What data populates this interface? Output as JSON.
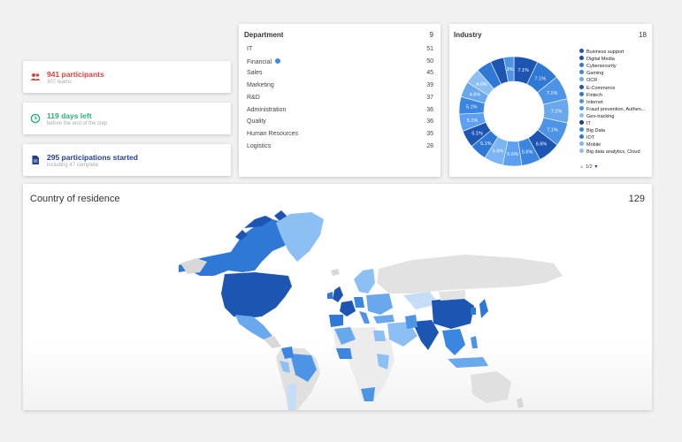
{
  "stats": [
    {
      "title": "941 participants",
      "subtitle": "307 teams",
      "color": "#e0413b",
      "icon": "people-icon"
    },
    {
      "title": "119 days left",
      "subtitle": "before the end of the step",
      "color": "#2aae7d",
      "icon": "clock-icon"
    },
    {
      "title": "295 participations started",
      "subtitle": "including 47 complete",
      "color": "#23408e",
      "icon": "document-icon"
    }
  ],
  "department": {
    "title": "Department",
    "count": "9",
    "rows": [
      {
        "label": "IT",
        "value": "51"
      },
      {
        "label": "Financial",
        "value": "50",
        "verified": true
      },
      {
        "label": "Sales",
        "value": "45"
      },
      {
        "label": "Marketing",
        "value": "39"
      },
      {
        "label": "R&D",
        "value": "37"
      },
      {
        "label": "Administration",
        "value": "36"
      },
      {
        "label": "Quality",
        "value": "36"
      },
      {
        "label": "Human Resources",
        "value": "35"
      },
      {
        "label": "Logistics",
        "value": "28"
      }
    ]
  },
  "industry": {
    "title": "Industry",
    "count": "18",
    "segments": [
      {
        "label": "7.1%",
        "value": 7.1,
        "color": "#1d55b3"
      },
      {
        "label": "7.1%",
        "value": 7.1,
        "color": "#2f78d6"
      },
      {
        "label": "7.1%",
        "value": 7.1,
        "color": "#4d94e6"
      },
      {
        "label": "7.1%",
        "value": 7.1,
        "color": "#6aa8ee"
      },
      {
        "label": "7.1%",
        "value": 7.1,
        "color": "#4d94e6"
      },
      {
        "label": "6.6%",
        "value": 6.6,
        "color": "#1d55b3"
      },
      {
        "label": "5.6%",
        "value": 5.6,
        "color": "#3a86e0"
      },
      {
        "label": "5.6%",
        "value": 5.6,
        "color": "#5d9ff0"
      },
      {
        "label": "5.6%",
        "value": 5.6,
        "color": "#7ab4f3"
      },
      {
        "label": "5.1%",
        "value": 5.1,
        "color": "#2f78d6"
      },
      {
        "label": "5.1%",
        "value": 5.1,
        "color": "#1d55b3"
      },
      {
        "label": "5.1%",
        "value": 5.1,
        "color": "#5d9ff0"
      },
      {
        "label": "5.1%",
        "value": 5.1,
        "color": "#3a86e0"
      },
      {
        "label": "4.6%",
        "value": 4.6,
        "color": "#6aa8ee"
      },
      {
        "label": "4.6%",
        "value": 4.6,
        "color": "#8cc0f5"
      },
      {
        "label": "",
        "value": 4.5,
        "color": "#2f78d6"
      },
      {
        "label": "",
        "value": 4.0,
        "color": "#1d55b3"
      },
      {
        "label": "3%",
        "value": 3.0,
        "color": "#4d94e6"
      }
    ],
    "legend": [
      {
        "label": "Business support",
        "color": "#1d55b3"
      },
      {
        "label": "Digital Media",
        "color": "#1b4aa8"
      },
      {
        "label": "Cybersecurity",
        "color": "#2f78d6"
      },
      {
        "label": "Gaming",
        "color": "#3a86e0"
      },
      {
        "label": "OCR",
        "color": "#6aa8ee"
      },
      {
        "label": "E-Commerce",
        "color": "#1d55b3"
      },
      {
        "label": "Fintech",
        "color": "#2f78d6"
      },
      {
        "label": "Internet",
        "color": "#4d94e6"
      },
      {
        "label": "Fraud prevention, Authen...",
        "color": "#4d94e6"
      },
      {
        "label": "Geo-tracking",
        "color": "#8cc0f5"
      },
      {
        "label": "IT",
        "color": "#1b3f8f"
      },
      {
        "label": "Big Data",
        "color": "#3a86e0"
      },
      {
        "label": "IOT",
        "color": "#2f78d6"
      },
      {
        "label": "Mobile",
        "color": "#7ab4f3"
      },
      {
        "label": "Big data analytics, Cloud",
        "color": "#8cc0f5"
      }
    ],
    "pager": "1/2"
  },
  "map": {
    "title": "Country of residence",
    "count": "129"
  }
}
